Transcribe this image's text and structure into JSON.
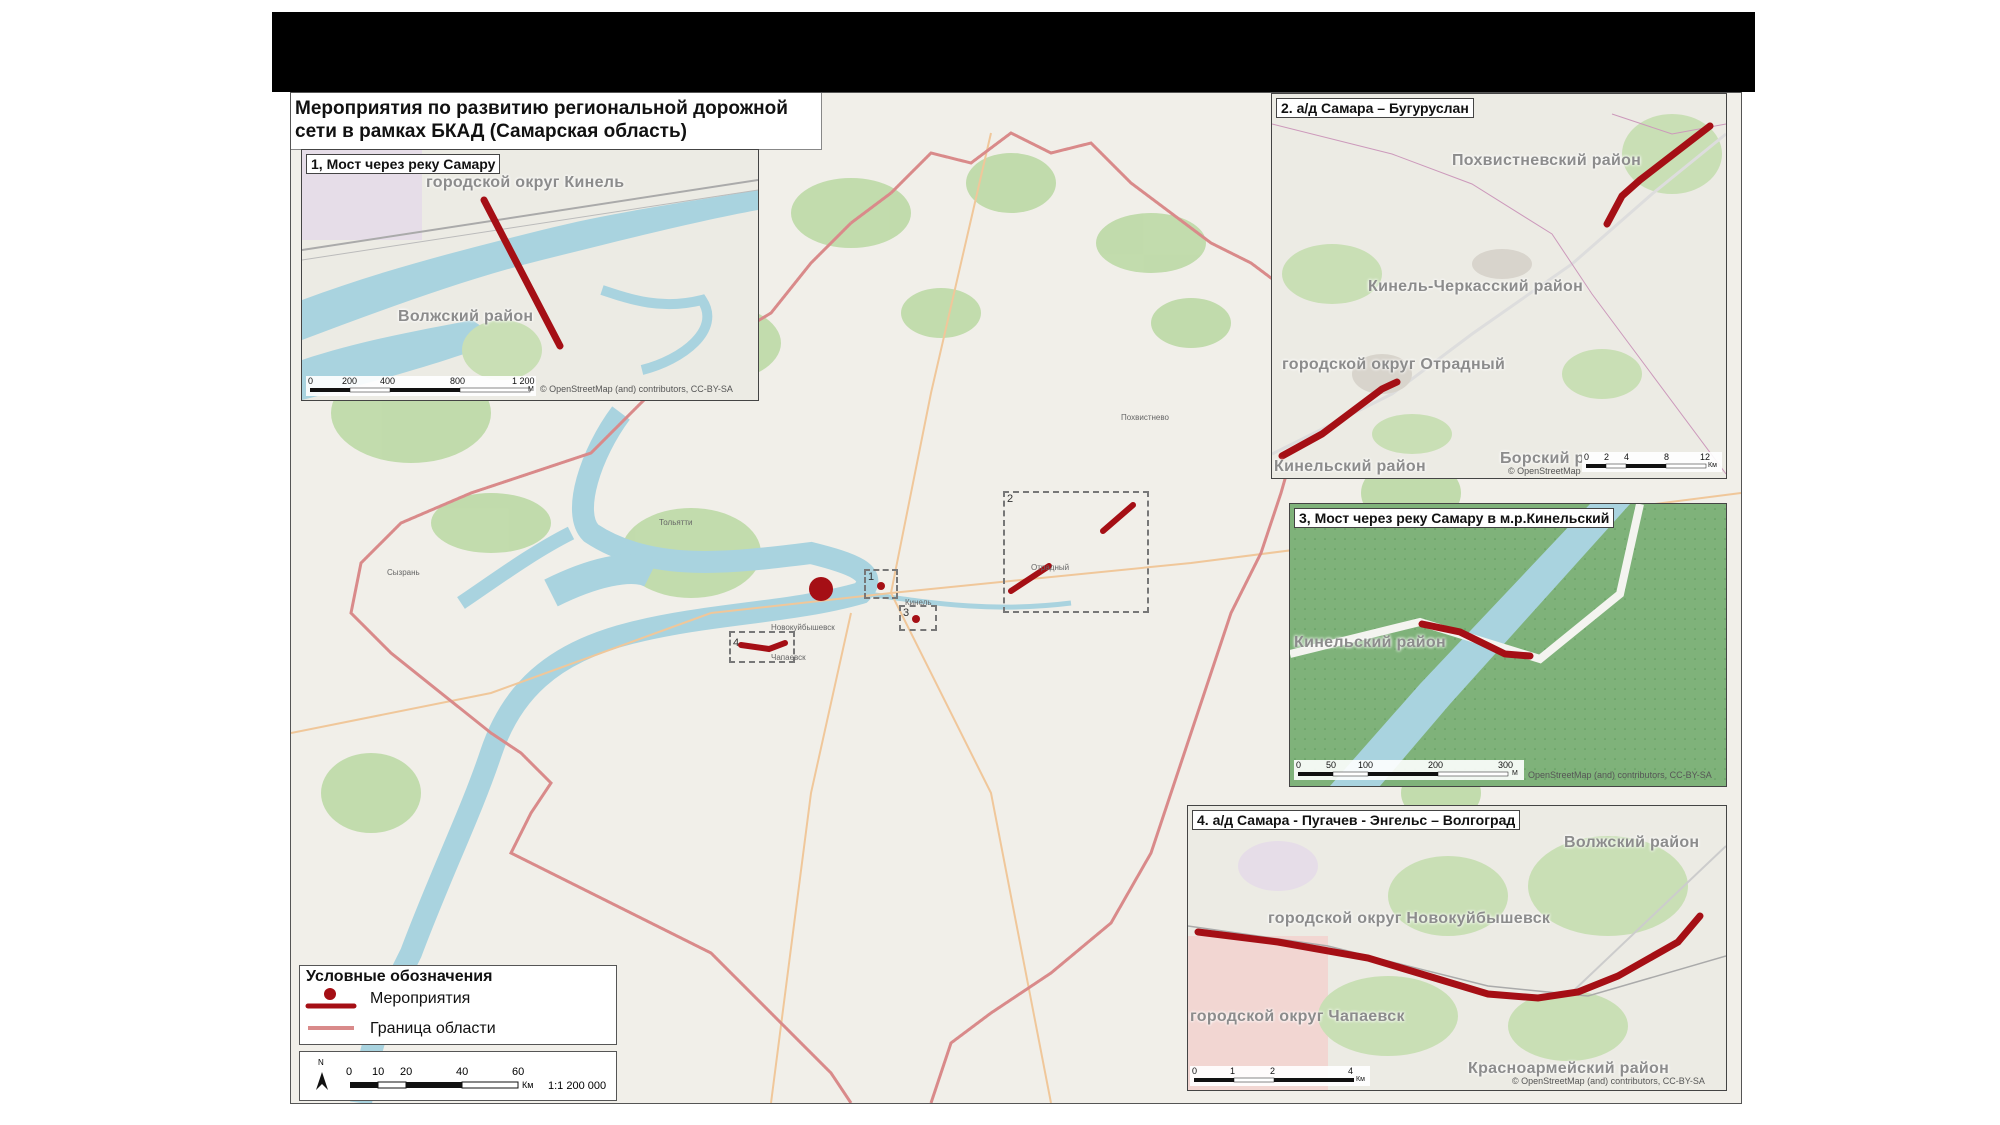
{
  "title": "Мероприятия по развитию региональной дорожной сети в рамках БКАД (Самарская область)",
  "title_lines": [
    "Мероприятия по развитию региональной дорожной",
    "сети в рамках БКАД (Самарская область)"
  ],
  "colors": {
    "project": "#a50f15",
    "border": "#d98a8a",
    "water": "#a9d3df",
    "forest": "#b7d7a0",
    "land": "#f1efe9"
  },
  "insets": [
    {
      "label": "1, Мост через реку Самару",
      "places": [
        "городской округ Кинель",
        "Волжский район"
      ],
      "scale": [
        "0",
        "200",
        "400",
        "800",
        "1 200"
      ],
      "scale_unit": "М",
      "copyright": "© OpenStreetMap (and) contributors, CC-BY-SA"
    },
    {
      "label": "2. а/д Самара – Бугуруслан",
      "places": [
        "Похвистневский район",
        "Кинель-Черкасский район",
        "городской округ Отрадный",
        "Кинельский район",
        "Борский р"
      ],
      "scale": [
        "0",
        "2",
        "4",
        "8",
        "12"
      ],
      "scale_unit": "Км",
      "copyright": "© OpenStreetMap"
    },
    {
      "label": "3, Мост через реку Самару в м.р.Кинельский",
      "places": [
        "Кинельский район"
      ],
      "scale": [
        "0",
        "50",
        "100",
        "200",
        "300"
      ],
      "scale_unit": "М",
      "copyright": "OpenStreetMap (and) contributors, CC-BY-SA"
    },
    {
      "label": "4. а/д Самара - Пугачев - Энгельс – Волгоград",
      "places": [
        "Волжский район",
        "городской округ Новокуйбышевск",
        "городской округ Чапаевск",
        "Красноармейский район"
      ],
      "scale": [
        "0",
        "1",
        "2",
        "4"
      ],
      "scale_unit": "Км",
      "copyright": "© OpenStreetMap (and) contributors, CC-BY-SA"
    }
  ],
  "main_map": {
    "box_numbers": [
      "1",
      "2",
      "3",
      "4"
    ],
    "towns": [
      "Тольятти",
      "Похвистнево",
      "Отрадный",
      "Кинель",
      "Новокуйбышевск",
      "Чапаевск",
      "Сызрань"
    ]
  },
  "legend": {
    "title": "Условные обозначения",
    "items": [
      "Мероприятия",
      "Граница области"
    ]
  },
  "main_scale": {
    "north": "N",
    "ticks": [
      "0",
      "10",
      "20",
      "40",
      "60"
    ],
    "unit": "Км",
    "ratio": "1:1 200 000"
  }
}
